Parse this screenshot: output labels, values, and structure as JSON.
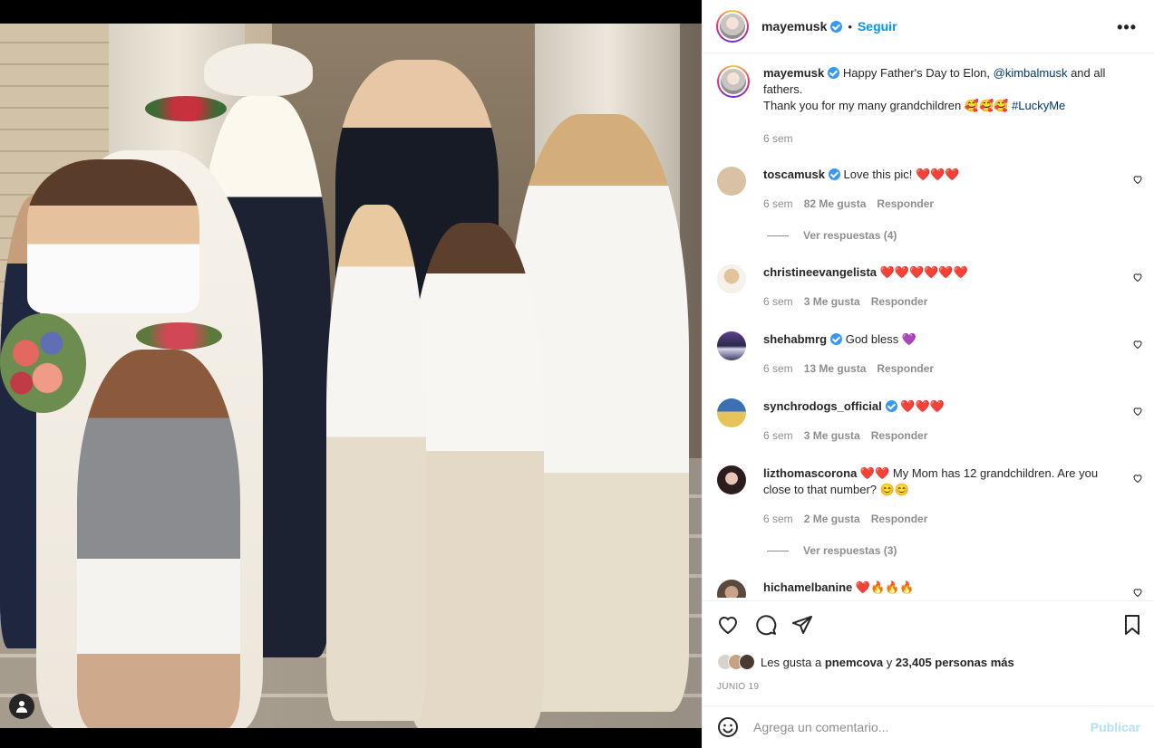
{
  "post": {
    "username": "mayemusk",
    "follow_label": "Seguir",
    "dot": "•",
    "more_label": "•••",
    "caption": {
      "username": "mayemusk",
      "text_1": "Happy Father's Day to Elon, ",
      "mention": "@kimbalmusk",
      "text_2": " and all fathers.",
      "text_3": "Thank you for my many grandchildren 🥰🥰🥰 ",
      "hashtag": "#LuckyMe",
      "time": "6 sem"
    }
  },
  "comments": [
    {
      "username": "toscamusk",
      "text": "Love this pic! ❤️❤️❤️",
      "time": "6 sem",
      "likes": "82 Me gusta",
      "reply": "Responder",
      "view_replies": "Ver respuestas (4)",
      "avatar_color": "#d8c1a4"
    },
    {
      "username": "christineevangelista",
      "text": "❤️❤️❤️❤️❤️❤️",
      "time": "6 sem",
      "likes": "3 Me gusta",
      "reply": "Responder",
      "avatar_color": "#efe4d7"
    },
    {
      "username": "shehabmrg",
      "text": "God bless 💜",
      "time": "6 sem",
      "likes": "13 Me gusta",
      "reply": "Responder",
      "avatar_color": "#3c3a67"
    },
    {
      "username": "synchrodogs_official",
      "text": "❤️❤️❤️",
      "time": "6 sem",
      "likes": "3 Me gusta",
      "reply": "Responder",
      "avatar_color": "#e7c45a"
    },
    {
      "username": "lizthomascorona",
      "text": "❤️❤️ My Mom has 12 grandchildren. Are you close to that number? 😊😊",
      "time": "6 sem",
      "likes": "2 Me gusta",
      "reply": "Responder",
      "view_replies": "Ver respuestas (3)",
      "avatar_color": "#3b2b2b"
    },
    {
      "username": "hichamelbanine",
      "text": "❤️🔥🔥🔥",
      "avatar_color": "#8b6d55"
    }
  ],
  "actions": {
    "likes_prefix": "Les gusta a ",
    "likes_user": "pnemcova",
    "likes_mid": " y ",
    "likes_count": "23,405 personas más",
    "date": "JUNIO 19"
  },
  "add_comment": {
    "placeholder": "Agrega un comentario...",
    "publish_label": "Publicar"
  },
  "colors": {
    "accent": "#0095f6",
    "verified": "#3897f0",
    "muted": "#8e8e8e",
    "link": "#00376b"
  }
}
